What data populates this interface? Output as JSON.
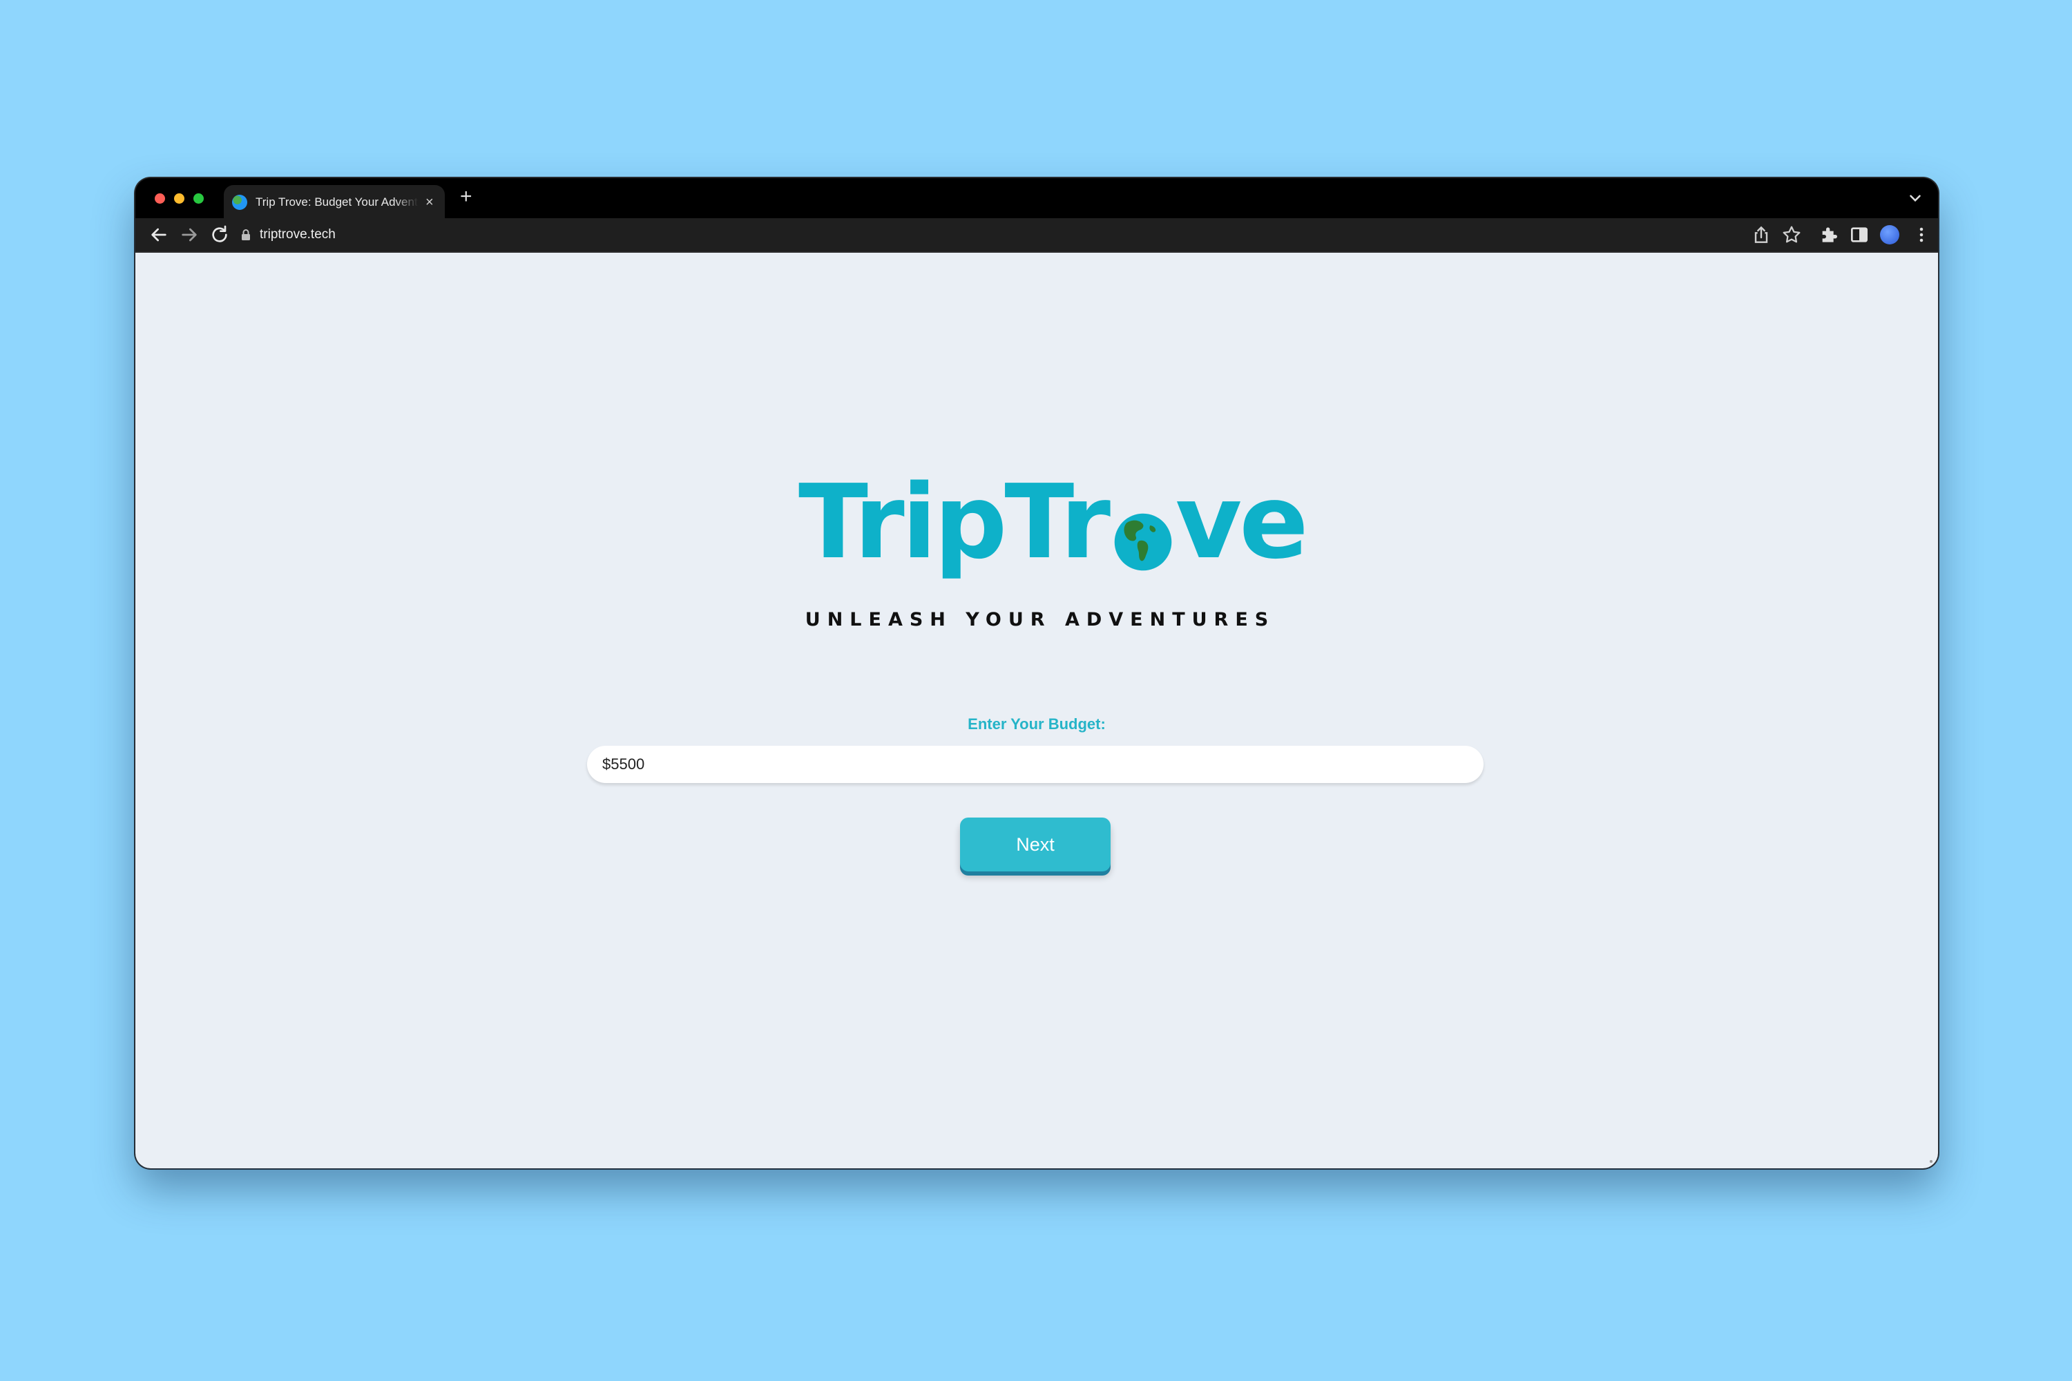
{
  "browser": {
    "tab": {
      "title": "Trip Trove: Budget Your Adventures",
      "close_label": "×"
    },
    "new_tab_label": "+",
    "url": "triptrove.tech"
  },
  "page": {
    "logo": {
      "part1": "TripTr",
      "part2": "ve"
    },
    "tagline": "UNLEASH YOUR ADVENTURES",
    "budget": {
      "label": "Enter Your Budget:",
      "value": "$5500"
    },
    "next_label": "Next"
  },
  "colors": {
    "background": "#8fd6fd",
    "brand": "#0eb1c9",
    "button": "#2fbccf",
    "content_bg": "#eaeff5"
  }
}
